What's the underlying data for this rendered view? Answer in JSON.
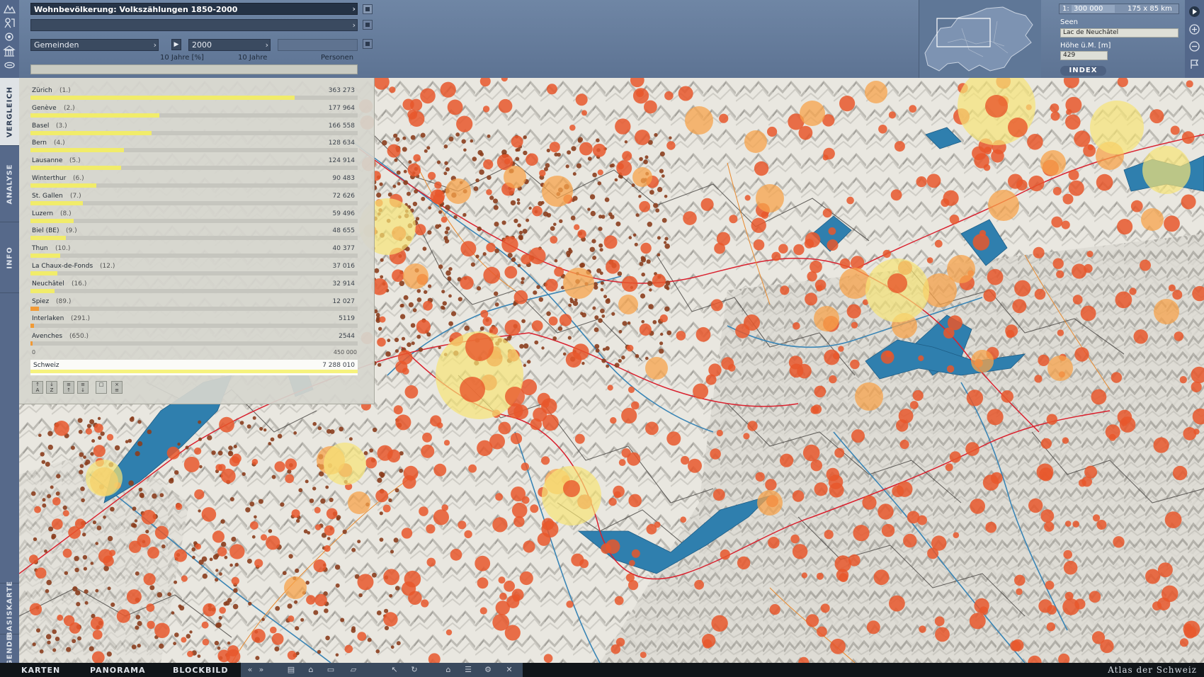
{
  "header": {
    "title": "Wohnbevölkerung: Volkszählungen 1850-2000",
    "level": "Gemeinden",
    "year": "2000",
    "columns": [
      "10 Jahre [%]",
      "10 Jahre",
      "Personen"
    ]
  },
  "info_panel": {
    "scale_prefix": "1:",
    "scale": "300 000",
    "extent": "175 x 85 km",
    "lakes_label": "Seen",
    "lake_name": "Lac de Neuchâtel",
    "altitude_label": "Höhe ü.M. [m]",
    "altitude": "429",
    "index_button": "INDEX"
  },
  "side_tabs": [
    "VERGLEICH",
    "ANALYSE",
    "INFO",
    "BASISKARTE",
    "LEGENDE"
  ],
  "ranking": {
    "axis_min": "0",
    "axis_max": "450 000",
    "rows": [
      {
        "name": "Zürich",
        "rank": "(1.)",
        "value": "363 273",
        "fraction": 0.807
      },
      {
        "name": "Genève",
        "rank": "(2.)",
        "value": "177 964",
        "fraction": 0.395
      },
      {
        "name": "Basel",
        "rank": "(3.)",
        "value": "166 558",
        "fraction": 0.37
      },
      {
        "name": "Bern",
        "rank": "(4.)",
        "value": "128 634",
        "fraction": 0.286
      },
      {
        "name": "Lausanne",
        "rank": "(5.)",
        "value": "124 914",
        "fraction": 0.278
      },
      {
        "name": "Winterthur",
        "rank": "(6.)",
        "value": "90 483",
        "fraction": 0.201
      },
      {
        "name": "St. Gallen",
        "rank": "(7.)",
        "value": "72 626",
        "fraction": 0.161
      },
      {
        "name": "Luzern",
        "rank": "(8.)",
        "value": "59 496",
        "fraction": 0.132
      },
      {
        "name": "Biel (BE)",
        "rank": "(9.)",
        "value": "48 655",
        "fraction": 0.108
      },
      {
        "name": "Thun",
        "rank": "(10.)",
        "value": "40 377",
        "fraction": 0.09
      },
      {
        "name": "La Chaux-de-Fonds",
        "rank": "(12.)",
        "value": "37 016",
        "fraction": 0.082
      },
      {
        "name": "Neuchâtel",
        "rank": "(16.)",
        "value": "32 914",
        "fraction": 0.073
      },
      {
        "name": "Spiez",
        "rank": "(89.)",
        "value": "12 027",
        "fraction": 0.027
      },
      {
        "name": "Interlaken",
        "rank": "(291.)",
        "value": "5119",
        "fraction": 0.011
      },
      {
        "name": "Avenches",
        "rank": "(650.)",
        "value": "2544",
        "fraction": 0.006
      }
    ],
    "total": {
      "name": "Schweiz",
      "value": "7 288 010"
    }
  },
  "bottom_tabs": [
    "KARTEN",
    "PANORAMA",
    "BLOCKBILD"
  ],
  "brand": "Atlas der Schweiz",
  "colors": {
    "lake": "#2f7fae",
    "symbol_small": "#8b3e1e",
    "symbol_medium": "#e8572b",
    "symbol_large": "#f7a34b",
    "symbol_city": "#f7e476",
    "road": "#d9212e",
    "river": "#3a85b5"
  }
}
